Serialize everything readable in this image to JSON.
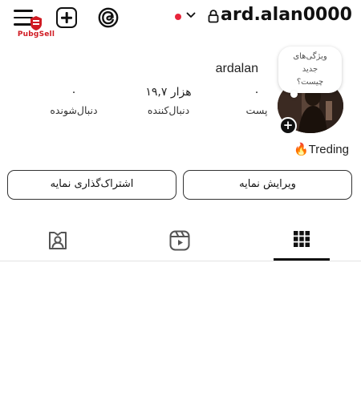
{
  "header": {
    "username": "ard.alan0000",
    "menu_icon": "hamburger-menu-icon",
    "create_icon": "add-square-icon",
    "threads_icon": "threads-icon",
    "account_switch_icon": "chevron-down-icon",
    "private_icon": "lock-icon",
    "live_dot_color": "#e8253b"
  },
  "watermark": {
    "text": "PubgSell",
    "color": "#d01a22"
  },
  "profile": {
    "display_name": "ardalan",
    "note": {
      "line1": "ویژگی‌های",
      "line2": "جدید",
      "line3": "چیست؟"
    },
    "bio": "🔥Treding",
    "add_story_label": "+"
  },
  "stats": {
    "posts": {
      "value": "۰",
      "label": "پست"
    },
    "followers": {
      "value": "۱۹,۷ هزار",
      "label": "دنبال‌کننده"
    },
    "following": {
      "value": "۰",
      "label": "دنبال‌شونده"
    }
  },
  "buttons": {
    "edit_profile": "ویرایش نمایه",
    "share_profile": "اشتراک‌گذاری نمایه"
  },
  "tabs": [
    {
      "name": "grid",
      "icon": "grid-icon",
      "active": true
    },
    {
      "name": "reels",
      "icon": "reels-icon",
      "active": false
    },
    {
      "name": "tagged",
      "icon": "tagged-icon",
      "active": false
    }
  ]
}
